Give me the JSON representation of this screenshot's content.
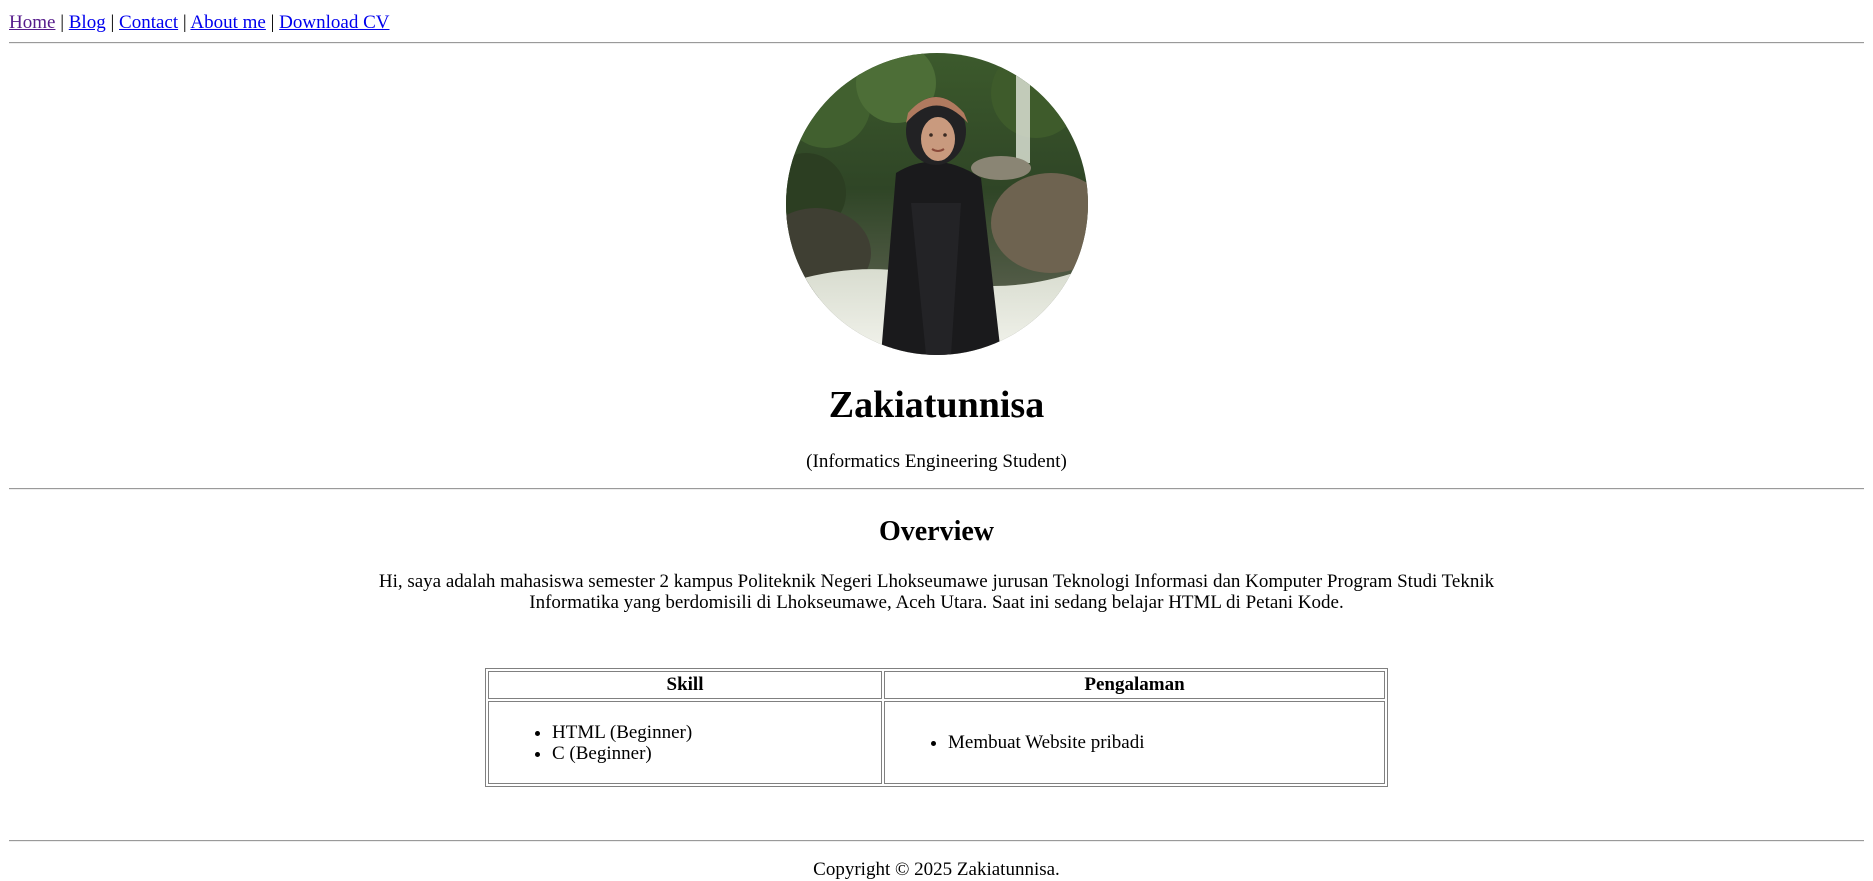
{
  "nav": {
    "links": [
      "Home",
      "Blog",
      "Contact",
      "About me",
      "Download CV"
    ],
    "separator": "|"
  },
  "profile": {
    "name": "Zakiatunnisa",
    "subtitle": "(Informatics Engineering Student)"
  },
  "overview": {
    "heading": "Overview",
    "text": "Hi, saya adalah mahasiswa semester 2 kampus Politeknik Negeri Lhokseumawe jurusan Teknologi Informasi dan Komputer Program Studi Teknik Informatika yang berdomisili di Lhokseumawe, Aceh Utara. Saat ini sedang belajar HTML di Petani Kode."
  },
  "table": {
    "headers": [
      "Skill",
      "Pengalaman"
    ],
    "skills": [
      "HTML (Beginner)",
      "C (Beginner)"
    ],
    "experience": [
      "Membuat Website pribadi"
    ]
  },
  "footer": {
    "copyright": "Copyright © 2025 Zakiatunnisa."
  },
  "colors": {
    "link": "#0000ee",
    "visited_link": "#551a8b",
    "rule": "#9a9a9a"
  }
}
